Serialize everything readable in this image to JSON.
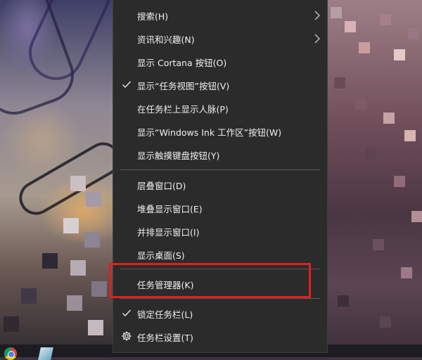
{
  "menu": {
    "items": [
      {
        "label": "搜索(H)",
        "submenu": true,
        "checked": false
      },
      {
        "label": "资讯和兴趣(N)",
        "submenu": true,
        "checked": false
      },
      {
        "label": "显示 Cortana 按钮(O)",
        "submenu": false,
        "checked": false
      },
      {
        "label": "显示“任务视图”按钮(V)",
        "submenu": false,
        "checked": true
      },
      {
        "label": "在任务栏上显示人脉(P)",
        "submenu": false,
        "checked": false
      },
      {
        "label": "显示“Windows Ink 工作区”按钮(W)",
        "submenu": false,
        "checked": false
      },
      {
        "label": "显示触摸键盘按钮(Y)",
        "submenu": false,
        "checked": false
      },
      {
        "label": "层叠窗口(D)",
        "submenu": false,
        "checked": false
      },
      {
        "label": "堆叠显示窗口(E)",
        "submenu": false,
        "checked": false
      },
      {
        "label": "并排显示窗口(I)",
        "submenu": false,
        "checked": false
      },
      {
        "label": "显示桌面(S)",
        "submenu": false,
        "checked": false
      },
      {
        "label": "任务管理器(K)",
        "submenu": false,
        "checked": false,
        "highlighted": true
      },
      {
        "label": "锁定任务栏(L)",
        "submenu": false,
        "checked": true
      },
      {
        "label": "任务栏设置(T)",
        "submenu": false,
        "checked": false,
        "icon": "gear-icon"
      }
    ]
  },
  "colors": {
    "menu_bg": "#2b2b2b",
    "menu_text": "#f0f0f0",
    "separator": "#5a5a5a",
    "highlight_outline": "#e0201b"
  },
  "taskbar": {
    "icons": [
      "chrome-icon",
      "app-icon"
    ]
  }
}
